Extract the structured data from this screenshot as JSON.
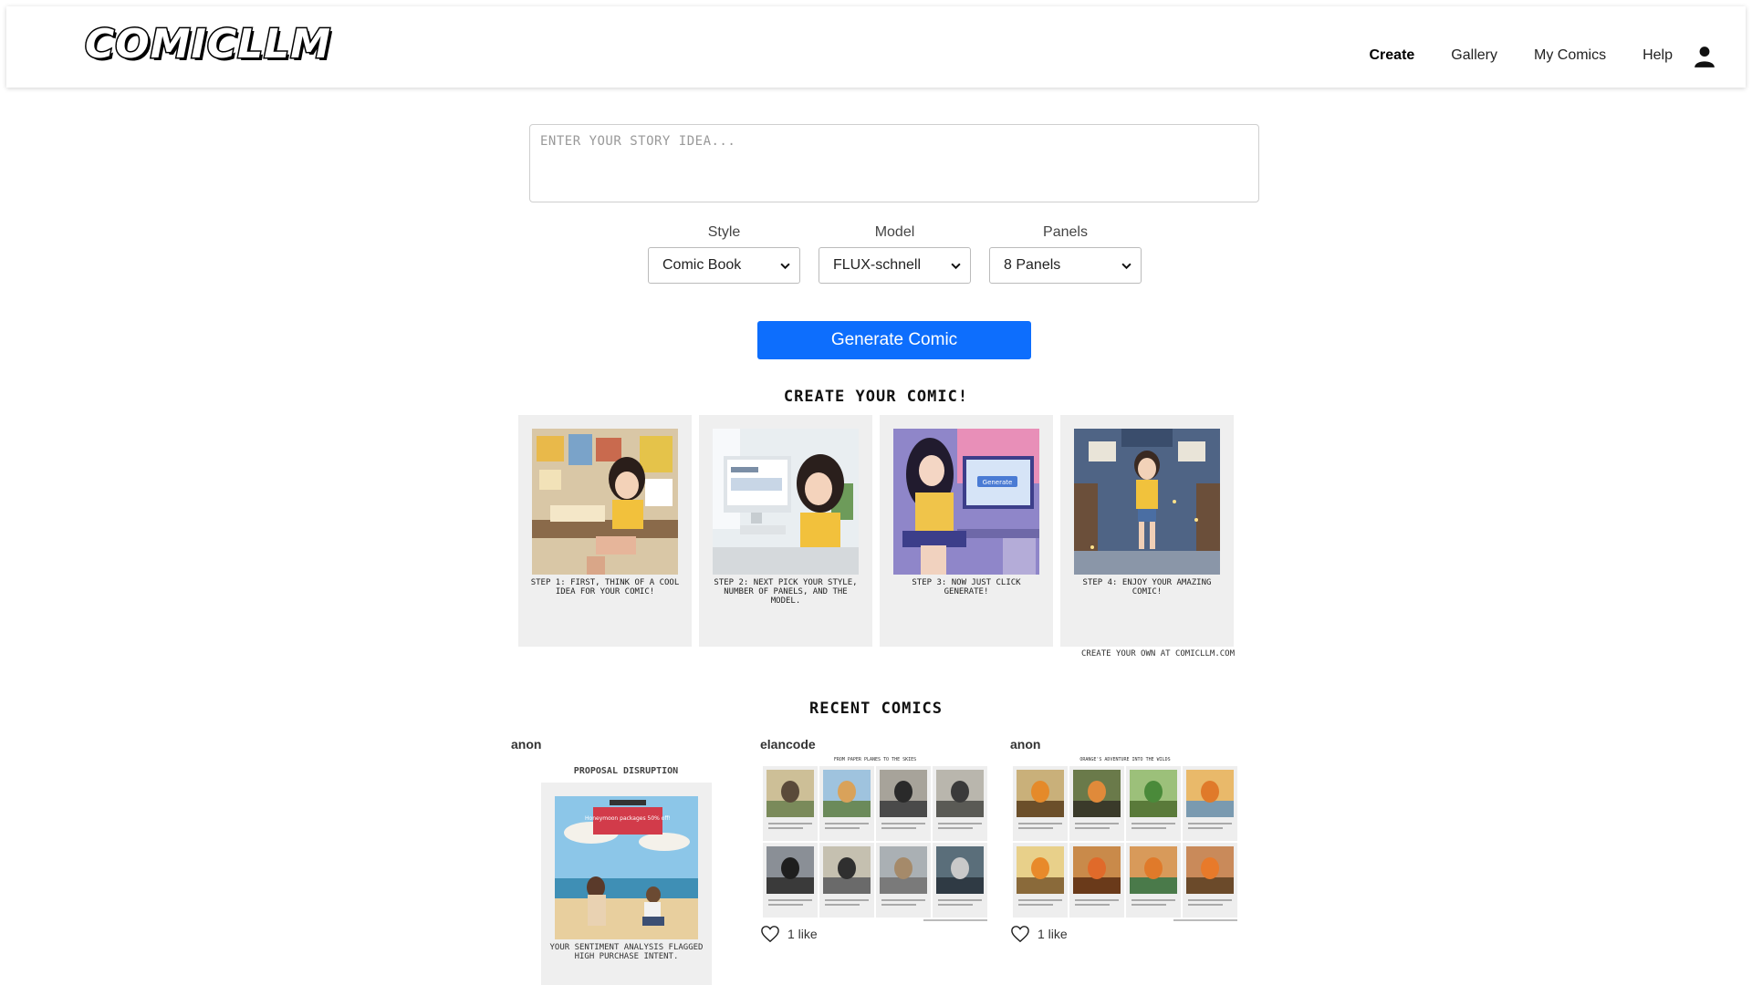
{
  "nav": {
    "logo": "COMICLLM",
    "links": [
      "Create",
      "Gallery",
      "My Comics",
      "Help"
    ],
    "active": "Create"
  },
  "form": {
    "story_placeholder": "Enter your story idea...",
    "style": {
      "label": "Style",
      "value": "Comic Book"
    },
    "model": {
      "label": "Model",
      "value": "FLUX-schnell"
    },
    "panels": {
      "label": "Panels",
      "value": "8 Panels"
    },
    "generate_label": "Generate Comic"
  },
  "tutorial": {
    "title": "Create your comic!",
    "steps": [
      "Step 1: First, think of a cool idea for your comic!",
      "Step 2: Next pick your style, number of panels, and the model.",
      "Step 3: Now just click generate!",
      "Step 4: Enjoy your amazing comic!"
    ],
    "credit": "Create your own at comicllm.com"
  },
  "recent": {
    "title": "Recent Comics",
    "cards": [
      {
        "author": "anon",
        "comic_title": "Proposal Disruption",
        "caption": "Your sentiment analysis flagged high purchase intent.",
        "banner": "Honeymoon packages 50% off!"
      },
      {
        "author": "elancode",
        "comic_title": "From Paper Planes to the Skies",
        "likes": "1 like"
      },
      {
        "author": "anon",
        "comic_title": "Orange's Adventure into the Wilds",
        "likes": "1 like"
      }
    ]
  },
  "colors": {
    "accent": "#0d6efd"
  }
}
